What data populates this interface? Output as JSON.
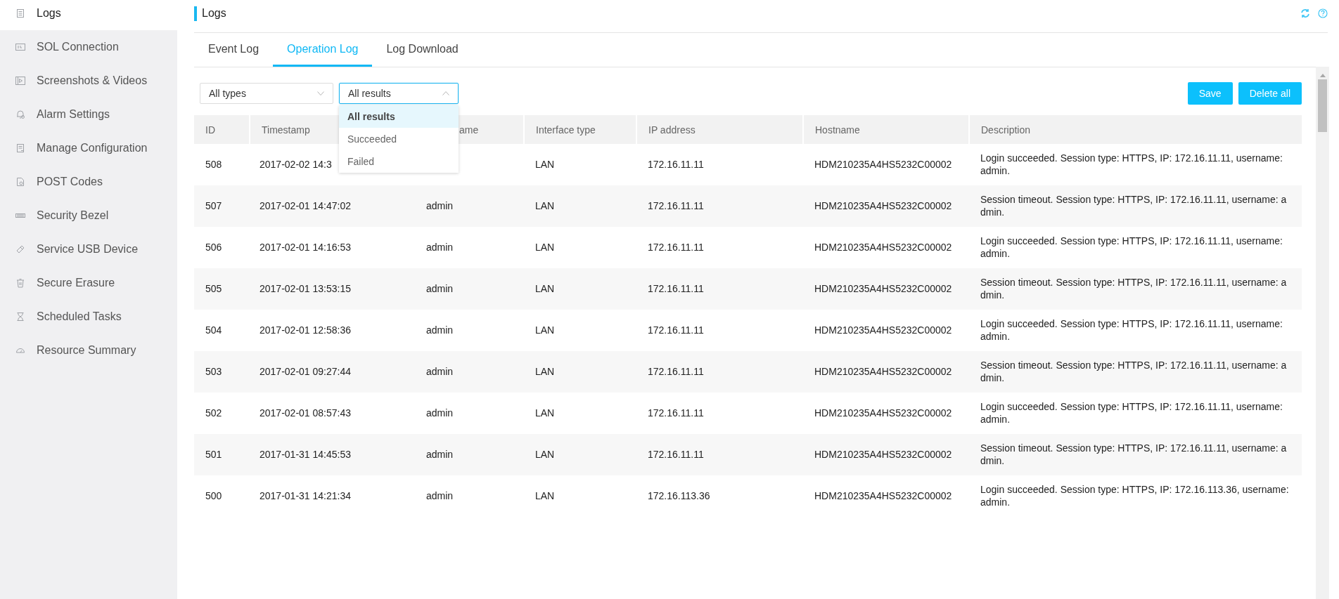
{
  "sidebar": {
    "items": [
      {
        "label": "Logs",
        "selected": true
      },
      {
        "label": "SOL Connection",
        "selected": false
      },
      {
        "label": "Screenshots & Videos",
        "selected": false
      },
      {
        "label": "Alarm Settings",
        "selected": false
      },
      {
        "label": "Manage Configuration",
        "selected": false
      },
      {
        "label": "POST Codes",
        "selected": false
      },
      {
        "label": "Security Bezel",
        "selected": false
      },
      {
        "label": "Service USB Device",
        "selected": false
      },
      {
        "label": "Secure Erasure",
        "selected": false
      },
      {
        "label": "Scheduled Tasks",
        "selected": false
      },
      {
        "label": "Resource Summary",
        "selected": false
      }
    ]
  },
  "page_title": "Logs",
  "tabs": [
    {
      "label": "Event Log",
      "selected": false
    },
    {
      "label": "Operation Log",
      "selected": true
    },
    {
      "label": "Log Download",
      "selected": false
    }
  ],
  "filters": {
    "type_select": {
      "value": "All types",
      "expanded": false
    },
    "result_select": {
      "value": "All results",
      "expanded": true,
      "options": [
        {
          "label": "All results",
          "selected": true
        },
        {
          "label": "Succeeded",
          "selected": false
        },
        {
          "label": "Failed",
          "selected": false
        }
      ]
    }
  },
  "buttons": [
    "Save",
    "Delete all"
  ],
  "table": {
    "columns": [
      "ID",
      "Timestamp",
      "ame",
      "Interface type",
      "IP address",
      "Hostname",
      "Description"
    ],
    "rows": [
      [
        "508",
        "2017-02-02 14:3",
        "",
        "LAN",
        "172.16.11.11",
        "HDM210235A4HS5232C00002",
        "Login succeeded. Session type: HTTPS, IP: 172.16.11.11, username: admin."
      ],
      [
        "507",
        "2017-02-01 14:47:02",
        "admin",
        "LAN",
        "172.16.11.11",
        "HDM210235A4HS5232C00002",
        "Session timeout. Session type: HTTPS, IP: 172.16.11.11, username: admin."
      ],
      [
        "506",
        "2017-02-01 14:16:53",
        "admin",
        "LAN",
        "172.16.11.11",
        "HDM210235A4HS5232C00002",
        "Login succeeded. Session type: HTTPS, IP: 172.16.11.11, username: admin."
      ],
      [
        "505",
        "2017-02-01 13:53:15",
        "admin",
        "LAN",
        "172.16.11.11",
        "HDM210235A4HS5232C00002",
        "Session timeout. Session type: HTTPS, IP: 172.16.11.11, username: admin."
      ],
      [
        "504",
        "2017-02-01 12:58:36",
        "admin",
        "LAN",
        "172.16.11.11",
        "HDM210235A4HS5232C00002",
        "Login succeeded. Session type: HTTPS, IP: 172.16.11.11, username: admin."
      ],
      [
        "503",
        "2017-02-01 09:27:44",
        "admin",
        "LAN",
        "172.16.11.11",
        "HDM210235A4HS5232C00002",
        "Session timeout. Session type: HTTPS, IP: 172.16.11.11, username: admin."
      ],
      [
        "502",
        "2017-02-01 08:57:43",
        "admin",
        "LAN",
        "172.16.11.11",
        "HDM210235A4HS5232C00002",
        "Login succeeded. Session type: HTTPS, IP: 172.16.11.11, username: admin."
      ],
      [
        "501",
        "2017-01-31 14:45:53",
        "admin",
        "LAN",
        "172.16.11.11",
        "HDM210235A4HS5232C00002",
        "Session timeout. Session type: HTTPS, IP: 172.16.11.11, username: admin."
      ],
      [
        "500",
        "2017-01-31 14:21:34",
        "admin",
        "LAN",
        "172.16.113.36",
        "HDM210235A4HS5232C00002",
        "Login succeeded. Session type: HTTPS, IP: 172.16.113.36, username: admin."
      ]
    ]
  }
}
